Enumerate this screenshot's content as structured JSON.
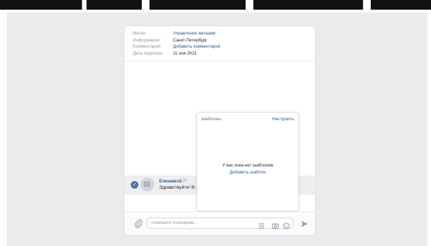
{
  "heading": {
    "text": "— — — — — — — — — — — — — — — — — — — — — — — — — —"
  },
  "info": {
    "rows": [
      {
        "label": "Метки:",
        "value": "Управление метками"
      },
      {
        "label": "Информация:",
        "value": "Санкт-Петербург"
      },
      {
        "label": "Комментарий:",
        "value": "Добавить комментарий"
      },
      {
        "label": "Дата подписки:",
        "value": "11 ноя 2021"
      }
    ]
  },
  "message": {
    "author": "Елизавета",
    "time": "9:20",
    "text": "Здравствуйте! В со",
    "check_icon": "check-icon",
    "avatar_icon": "camera-icon"
  },
  "templates": {
    "title": "Шаблоны",
    "settings_label": "Настроить",
    "empty_text": "У вас пока нет шаблонов",
    "add_label": "Добавить шаблон"
  },
  "composer": {
    "placeholder": "Напишите сообщение...",
    "attach_icon": "paperclip-icon",
    "templates_icon": "list-icon",
    "camera_icon": "camera-icon",
    "emoji_icon": "smile-icon",
    "send_icon": "send-icon"
  },
  "colors": {
    "accent": "#4a76a8",
    "link": "#2a5885",
    "background": "#ebebeb"
  }
}
